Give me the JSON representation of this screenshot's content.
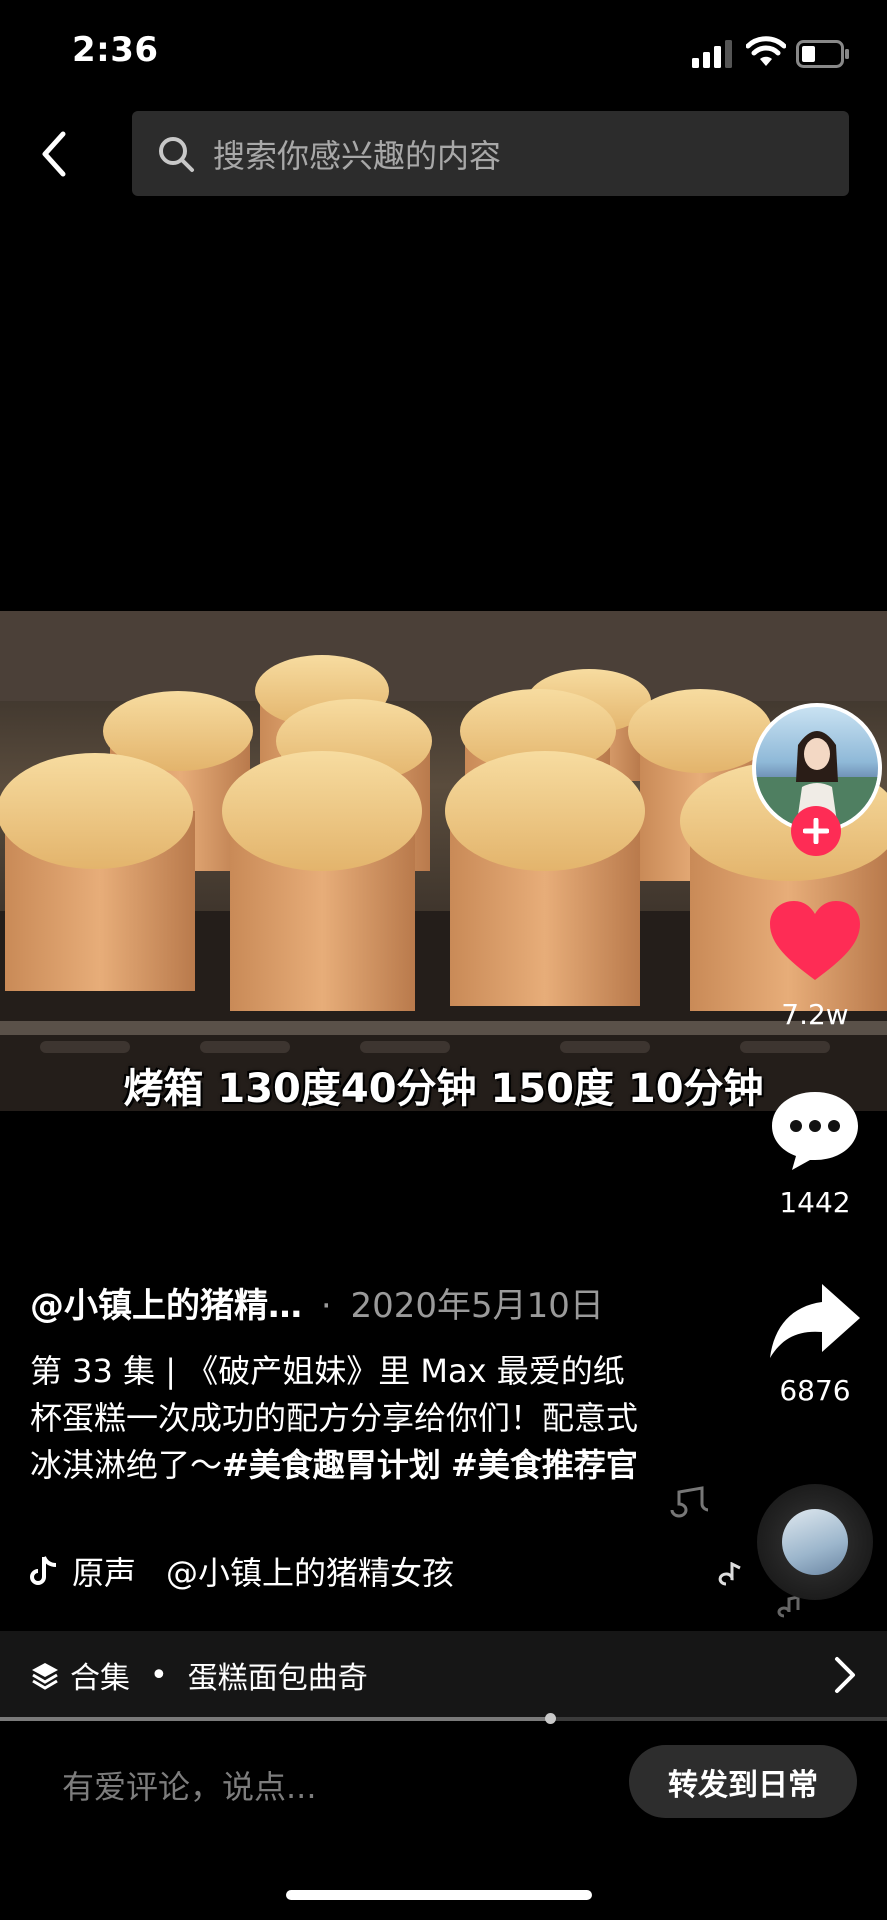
{
  "status_bar": {
    "time": "2:36"
  },
  "search": {
    "placeholder": "搜索你感兴趣的内容"
  },
  "video": {
    "subtitle": "烤箱 130度40分钟 150度 10分钟",
    "progress": 0.62
  },
  "sidebar": {
    "likes": "7.2w",
    "comments": "1442",
    "shares": "6876"
  },
  "post": {
    "author": "@小镇上的猪精…",
    "dot": "·",
    "date": "2020年5月10日",
    "caption_text": "第 33 集 | 《破产姐妹》里 Max 最爱的纸杯蛋糕一次成功的配方分享给你们！配意式冰淇淋绝了～",
    "tag1": "#美食趣胃计划",
    "tag2": "#美食推荐官",
    "music_label": "原声",
    "music_author": "@小镇上的猪精女孩"
  },
  "collection": {
    "label": "合集",
    "dot": "•",
    "name": "蛋糕面包曲奇"
  },
  "bottom": {
    "comment_placeholder": "有爱评论，说点...",
    "repost_label": "转发到日常"
  },
  "colors": {
    "accent": "#fe2c55",
    "background": "#000000",
    "bar": "#161616"
  }
}
